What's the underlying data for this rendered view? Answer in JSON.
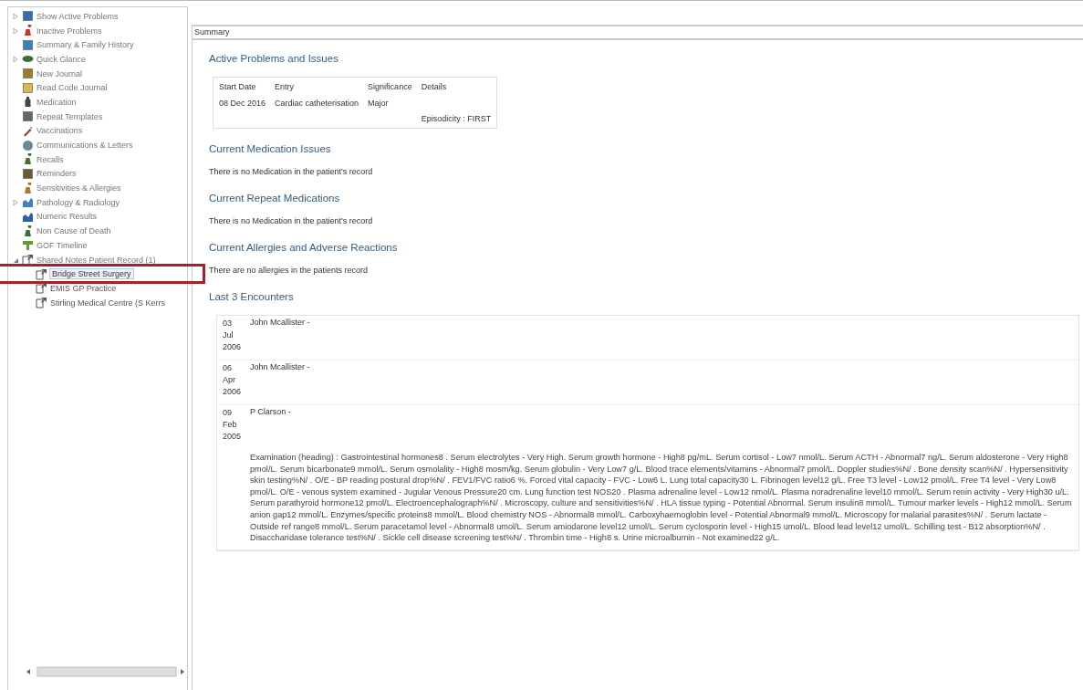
{
  "sidebar": {
    "items": [
      {
        "label": "Show Active Problems",
        "expanded": false
      },
      {
        "label": "Inactive Problems",
        "expanded": false
      },
      {
        "label": "Summary & Family History"
      },
      {
        "label": "Quick Glance",
        "expanded": false
      },
      {
        "label": "New Journal"
      },
      {
        "label": "Read Code Journal"
      },
      {
        "label": "Medication"
      },
      {
        "label": "Repeat Templates"
      },
      {
        "label": "Vaccinations"
      },
      {
        "label": "Communications & Letters"
      },
      {
        "label": "Recalls"
      },
      {
        "label": "Reminders"
      },
      {
        "label": "Sensitivities & Allergies"
      },
      {
        "label": "Pathology & Radiology",
        "expanded": false
      },
      {
        "label": "Numeric Results"
      },
      {
        "label": "Non Cause of Death"
      },
      {
        "label": "GOF Timeline"
      },
      {
        "label": "Shared Notes Patient Record (1)",
        "expanded": true,
        "children": [
          {
            "label": "Bridge Street Surgery",
            "selected": true
          },
          {
            "label": "EMIS GP Practice",
            "selected": false
          },
          {
            "label": "Stirling Medical Centre (S Kerrs",
            "selected": false
          }
        ]
      }
    ]
  },
  "summary": {
    "title": "Summary",
    "active_problems": {
      "heading": "Active Problems and Issues",
      "columns": [
        "Start Date",
        "Entry",
        "Significance",
        "Details"
      ],
      "rows": [
        {
          "start_date": "08 Dec 2016",
          "entry": "Cardiac catheterisation",
          "significance": "Major",
          "details": "Episodicity : FIRST"
        }
      ]
    },
    "sections": [
      {
        "heading": "Current Medication Issues",
        "text": "There is no Medication in the patient's record"
      },
      {
        "heading": "Current Repeat Medications",
        "text": "There is no Medication in the patient's record"
      },
      {
        "heading": "Current Allergies and Adverse Reactions",
        "text": "There are no allergies in the patients record"
      }
    ],
    "encounters": {
      "heading": "Last 3 Encounters",
      "rows": [
        {
          "date": "03 Jul 2006",
          "clinician": "John Mcallister -"
        },
        {
          "date": "06 Apr 2006",
          "clinician": "John Mcallister -"
        },
        {
          "date": "09 Feb 2005",
          "clinician": "P Clarson -",
          "details": "Examination (heading) : Gastrointestinal hormones8 . Serum electrolytes - Very High. Serum growth hormone - High8 pg/mL. Serum cortisol - Low7 nmol/L. Serum ACTH - Abnormal7 ng/L. Serum aldosterone - Very High8 pmol/L. Serum bicarbonate9 mmol/L. Serum osmolality - High8 mosm/kg. Serum globulin - Very Low7 g/L. Blood trace elements/vitamins - Abnormal7 pmol/L. Doppler studies%N/ . Bone density scan%N/ . Hypersensitivity skin testing%N/ . O/E - BP reading postural drop%N/ . FEV1/FVC ratio6 %. Forced vital capacity - FVC - Low6 L. Lung total capacity30 L. Fibrinogen level12 g/L. Free T3 level - Low12 pmol/L. Free T4 level - Very Low8 pmol/L. O/E - venous system examined - Jugular Venous Pressure20 cm. Lung function test NOS20 . Plasma adrenaline level - Low12 nmol/L. Plasma noradrenaline level10 mmol/L. Serum renin activity - Very High30 u/L. Serum parathyroid hormone12 pmol/L. Electroencephalograph%N/ . Microscopy, culture and sensitivities%N/ . HLA tissue typing - Potential Abnormal. Serum insulin8 mmol/L. Tumour marker levels - High12 mmol/L. Serum anion gap12 mmol/L. Enzymes/specific proteins8 mmol/L. Blood chemistry NOS - Abnormal8 mmol/L. Carboxyhaemoglobin level - Potential Abnormal9 mmol/L. Microscopy for malarial parasites%N/ . Serum lactate - Outside ref range8 mmol/L. Serum paracetamol level - Abnormal8 umol/L. Serum amiodarone level12 umol/L. Serum cyclosporin level - High15 umol/L. Blood lead level12 umol/L. Schilling test - B12 absorption%N/ . Disaccharidase tolerance test%N/ . Sickle cell disease screening test%N/ . Thrombin time - High8 s. Urine microalbumin - Not examined22 g/L."
        }
      ]
    }
  }
}
